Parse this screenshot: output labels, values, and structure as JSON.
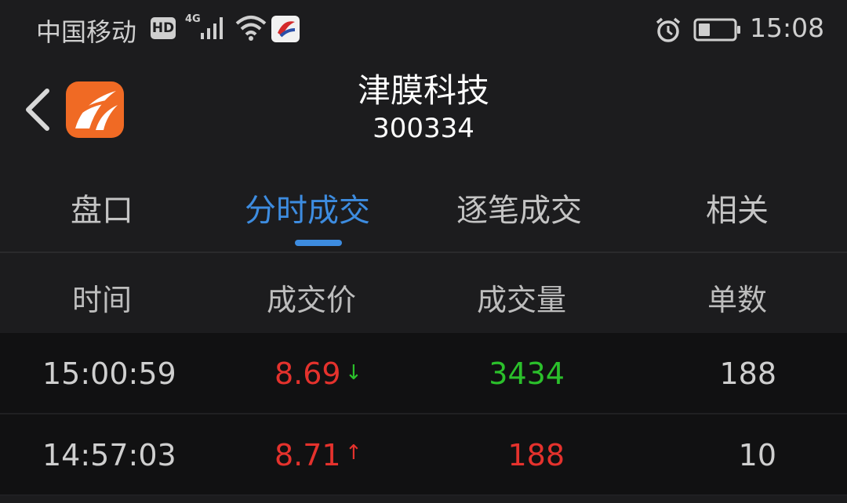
{
  "status_bar": {
    "carrier": "中国移动",
    "hd_badge": "HD",
    "network": "4G",
    "time": "15:08",
    "icons": [
      "signal-icon",
      "wifi-icon",
      "app-notification-icon",
      "alarm-icon",
      "battery-icon"
    ]
  },
  "header": {
    "stock_name": "津膜科技",
    "stock_code": "300334"
  },
  "tabs": [
    {
      "label": "盘口",
      "active": false
    },
    {
      "label": "分时成交",
      "active": true
    },
    {
      "label": "逐笔成交",
      "active": false
    },
    {
      "label": "相关",
      "active": false
    }
  ],
  "table": {
    "columns": [
      "时间",
      "成交价",
      "成交量",
      "单数"
    ],
    "rows": [
      {
        "time": "15:00:59",
        "price": "8.69",
        "direction": "down",
        "volume": "3434",
        "volume_color": "#2bc02b",
        "count": "188"
      },
      {
        "time": "14:57:03",
        "price": "8.71",
        "direction": "up",
        "volume": "188",
        "volume_color": "#e5322d",
        "count": "10"
      }
    ]
  },
  "colors": {
    "accent": "#3d8ce0",
    "up": "#e5322d",
    "down": "#2bc02b",
    "background": "#1c1c1e",
    "row_background": "#111112"
  }
}
